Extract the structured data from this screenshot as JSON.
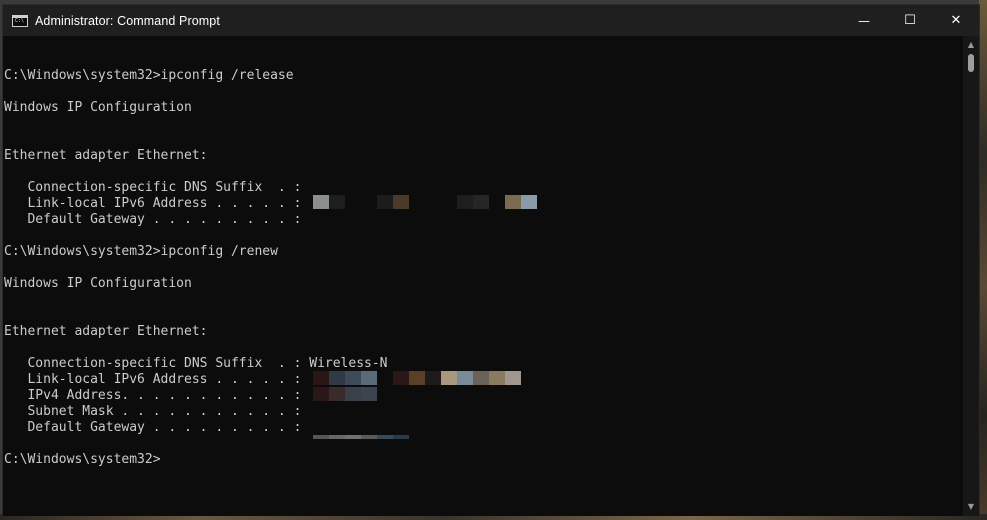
{
  "window": {
    "title": "Administrator: Command Prompt",
    "icon_text": "C:\\",
    "controls": {
      "minimize": "—",
      "maximize": "☐",
      "close": "✕"
    }
  },
  "console": {
    "lines": [
      "",
      "C:\\Windows\\system32>ipconfig /release",
      "",
      "Windows IP Configuration",
      "",
      "",
      "Ethernet adapter Ethernet:",
      "",
      "   Connection-specific DNS Suffix  . :",
      "   Link-local IPv6 Address . . . . . :",
      "   Default Gateway . . . . . . . . . :",
      "",
      "C:\\Windows\\system32>ipconfig /renew",
      "",
      "Windows IP Configuration",
      "",
      "",
      "Ethernet adapter Ethernet:",
      "",
      "   Connection-specific DNS Suffix  . : Wireless-N",
      "   Link-local IPv6 Address . . . . . :",
      "   IPv4 Address. . . . . . . . . . . :",
      "   Subnet Mask . . . . . . . . . . . :",
      "   Default Gateway . . . . . . . . . :",
      "",
      "C:\\Windows\\system32>"
    ]
  },
  "redactions": [
    {
      "label": "release-ipv6-address",
      "colors": [
        "#8a8f8e",
        "#1e1e1e",
        "",
        "",
        "#1c1c1c",
        "#4a3a28",
        "",
        "",
        "",
        "#1e1e1e",
        "#262626",
        "",
        "#7a6a50",
        "#8a9aa8"
      ]
    },
    {
      "label": "renew-ipv6-address",
      "colors": [
        "#2a1616",
        "#303a44",
        "#3e4a58",
        "#5a6a7a",
        "",
        "#2a1818",
        "#5a4028",
        "#1e1a18",
        "#a89880",
        "#7a8a98",
        "#6a6258",
        "#8a7a60",
        "#a09890"
      ]
    },
    {
      "label": "renew-ipv4-address",
      "colors": [
        "#2a1818",
        "#3a2a2a",
        "#3a4048",
        "#3c4450"
      ]
    },
    {
      "label": "renew-default-gateway",
      "colors": [
        "#555555",
        "#666666",
        "#707070",
        "#5a5a5a",
        "#3a4a5a",
        "#2a3a4a"
      ]
    }
  ]
}
